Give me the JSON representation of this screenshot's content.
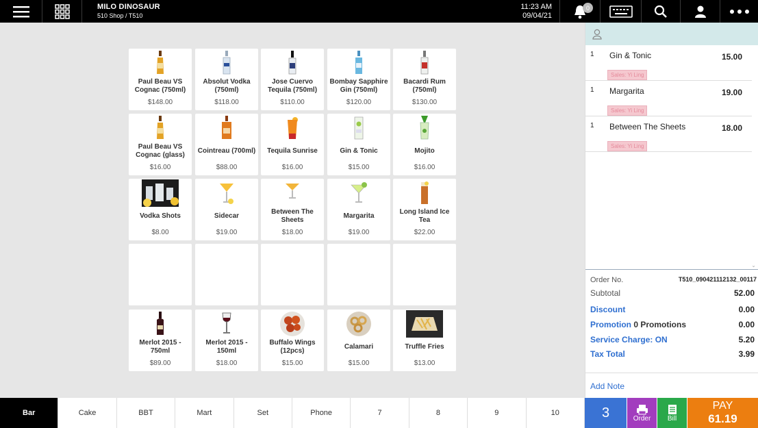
{
  "header": {
    "account_name": "MILO DINOSAUR",
    "shop_terminal": "510 Shop / T510",
    "time": "11:23 AM",
    "date": "09/04/21",
    "notification_count": "0"
  },
  "products": [
    {
      "name": "Paul Beau VS Cognac (750ml)",
      "price": "$148.00",
      "icon": "cognac-bottle-icon"
    },
    {
      "name": "Absolut Vodka (750ml)",
      "price": "$118.00",
      "icon": "vodka-bottle-icon"
    },
    {
      "name": "Jose Cuervo Tequila (750ml)",
      "price": "$110.00",
      "icon": "tequila-bottle-icon"
    },
    {
      "name": "Bombay Sapphire Gin (750ml)",
      "price": "$120.00",
      "icon": "gin-bottle-icon"
    },
    {
      "name": "Bacardi Rum (750ml)",
      "price": "$130.00",
      "icon": "rum-bottle-icon"
    },
    {
      "name": "Paul Beau VS Cognac (glass)",
      "price": "$16.00",
      "icon": "cognac-bottle-icon"
    },
    {
      "name": "Cointreau (700ml)",
      "price": "$88.00",
      "icon": "cointreau-bottle-icon"
    },
    {
      "name": "Tequila Sunrise",
      "price": "$16.00",
      "icon": "tequila-sunrise-icon"
    },
    {
      "name": "Gin & Tonic",
      "price": "$15.00",
      "icon": "gin-tonic-icon"
    },
    {
      "name": "Mojito",
      "price": "$16.00",
      "icon": "mojito-icon"
    },
    {
      "name": "Vodka Shots",
      "price": "$8.00",
      "icon": "vodka-shots-photo"
    },
    {
      "name": "Sidecar",
      "price": "$19.00",
      "icon": "sidecar-glass-icon"
    },
    {
      "name": "Between The Sheets",
      "price": "$18.00",
      "icon": "cocktail-glass-icon"
    },
    {
      "name": "Margarita",
      "price": "$19.00",
      "icon": "margarita-glass-icon"
    },
    {
      "name": "Long Island Ice Tea",
      "price": "$22.00",
      "icon": "long-island-glass-icon"
    },
    {
      "name": "",
      "price": ""
    },
    {
      "name": "",
      "price": ""
    },
    {
      "name": "",
      "price": ""
    },
    {
      "name": "",
      "price": ""
    },
    {
      "name": "",
      "price": ""
    },
    {
      "name": "Merlot 2015 - 750ml",
      "price": "$89.00",
      "icon": "wine-bottle-icon"
    },
    {
      "name": "Merlot 2015 - 150ml",
      "price": "$18.00",
      "icon": "wine-glass-icon"
    },
    {
      "name": "Buffalo Wings (12pcs)",
      "price": "$15.00",
      "icon": "buffalo-wings-photo"
    },
    {
      "name": "Calamari",
      "price": "$15.00",
      "icon": "calamari-photo"
    },
    {
      "name": "Truffle Fries",
      "price": "$13.00",
      "icon": "truffle-fries-photo"
    }
  ],
  "order": {
    "lines": [
      {
        "qty": "1",
        "name": "Gin & Tonic",
        "price": "15.00",
        "sales_tag": "Sales: Yi Ling"
      },
      {
        "qty": "1",
        "name": "Margarita",
        "price": "19.00",
        "sales_tag": "Sales: Yi Ling"
      },
      {
        "qty": "1",
        "name": "Between The Sheets",
        "price": "18.00",
        "sales_tag": "Sales: Yi Ling"
      }
    ],
    "order_no_label": "Order No.",
    "order_no": "T510_090421112132_00117",
    "subtotal_label": "Subtotal",
    "subtotal": "52.00",
    "discount_label": "Discount",
    "discount": "0.00",
    "promotion_label": "Promotion",
    "promotion_count": "0 Promotions",
    "promotion": "0.00",
    "service_label": "Service Charge: ON",
    "service": "5.20",
    "tax_label": "Tax Total",
    "tax": "3.99",
    "add_note": "Add Note"
  },
  "categories": [
    "Bar",
    "Cake",
    "BBT",
    "Mart",
    "Set",
    "Phone",
    "7",
    "8",
    "9",
    "10"
  ],
  "actions": {
    "item_count": "3",
    "order_label": "Order",
    "bill_label": "Bill",
    "pay_label": "PAY",
    "pay_amount": "61.19"
  },
  "colors": {
    "accent_blue": "#3a73d4",
    "order_purple": "#a23dbe",
    "bill_green": "#2aa84a",
    "pay_orange": "#ec7e10"
  }
}
